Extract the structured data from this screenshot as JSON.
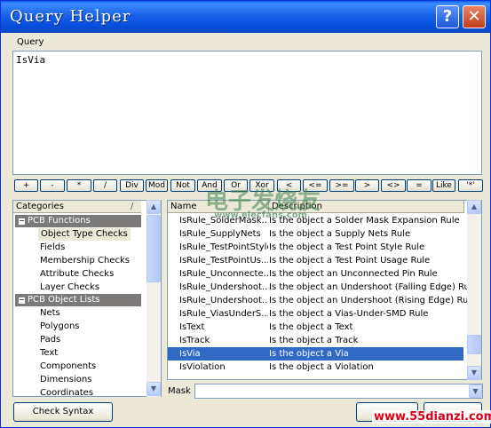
{
  "window": {
    "title": "Query Helper"
  },
  "titlebar_buttons": {
    "help": "?",
    "close": "✕"
  },
  "query": {
    "label": "Query",
    "text": "IsVia"
  },
  "operators": [
    "+",
    "-",
    "*",
    "/",
    "Div",
    "Mod",
    "Not",
    "And",
    "Or",
    "Xor",
    "<",
    "<=",
    ">=",
    ">",
    "<>",
    "=",
    "Like",
    "'*'"
  ],
  "categories": {
    "header": "Categories",
    "groups": [
      {
        "label": "PCB Functions",
        "items": [
          "Object Type Checks",
          "Fields",
          "Membership Checks",
          "Attribute Checks",
          "Layer Checks"
        ],
        "selected": "Object Type Checks"
      },
      {
        "label": "PCB Object Lists",
        "items": [
          "Nets",
          "Polygons",
          "Pads",
          "Text",
          "Components",
          "Dimensions",
          "Coordinates"
        ]
      }
    ]
  },
  "list": {
    "columns": [
      "Name",
      "Description"
    ],
    "rows": [
      {
        "name": "IsRule_SolderMask...",
        "desc": "Is the object a Solder Mask Expansion Rule"
      },
      {
        "name": "IsRule_SupplyNets",
        "desc": "Is the object a Supply Nets Rule"
      },
      {
        "name": "IsRule_TestPointStyle",
        "desc": "Is the object a Test Point Style Rule"
      },
      {
        "name": "IsRule_TestPointUs...",
        "desc": "Is the object a Test Point Usage Rule"
      },
      {
        "name": "IsRule_Unconnecte...",
        "desc": "Is the object an Unconnected Pin Rule"
      },
      {
        "name": "IsRule_Undershoot...",
        "desc": "Is the object an Undershoot (Falling Edge) Rule"
      },
      {
        "name": "IsRule_Undershoot...",
        "desc": "Is the object an Undershoot (Rising Edge) Rule"
      },
      {
        "name": "IsRule_ViasUnderS...",
        "desc": "Is the object a Vias-Under-SMD Rule"
      },
      {
        "name": "IsText",
        "desc": "Is the object a Text"
      },
      {
        "name": "IsTrack",
        "desc": "Is the object a Track"
      },
      {
        "name": "IsVia",
        "desc": "Is the object a Via"
      },
      {
        "name": "IsViolation",
        "desc": "Is the object a Violation"
      }
    ],
    "selected_index": 10
  },
  "mask": {
    "label": "Mask",
    "value": ""
  },
  "buttons": {
    "check_syntax": "Check Syntax"
  },
  "watermark": {
    "top": "电子发烧友",
    "top_url": "www.elecfans.com",
    "bottom": "www.55dianzi.com"
  }
}
